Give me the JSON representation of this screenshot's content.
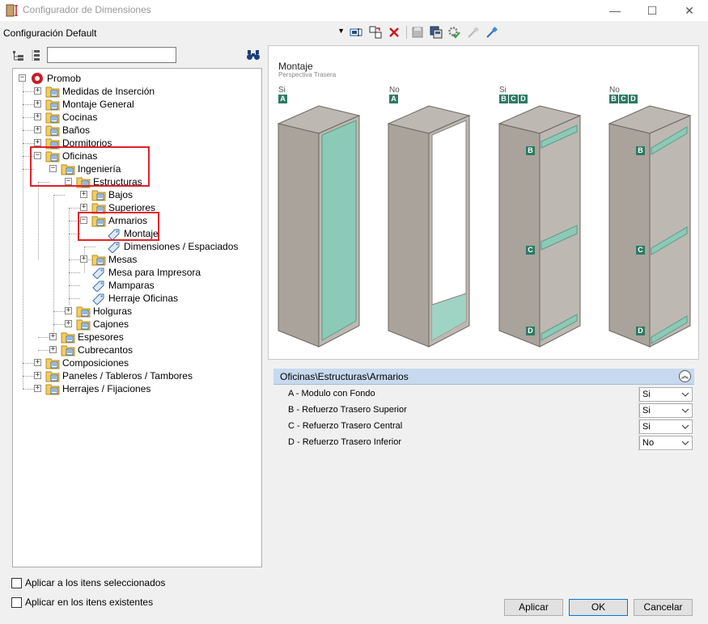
{
  "window": {
    "title": "Configurador de Dimensiones",
    "min": "—",
    "max": "☐",
    "close": "✕"
  },
  "config": {
    "selected": "Configuración Default"
  },
  "search": {
    "value": ""
  },
  "tree": {
    "items": [
      {
        "label": "Promob"
      },
      {
        "label": "Medidas de Inserción"
      },
      {
        "label": "Montaje General"
      },
      {
        "label": "Cocinas"
      },
      {
        "label": "Baños"
      },
      {
        "label": "Dormitorios"
      },
      {
        "label": "Oficinas"
      },
      {
        "label": "Ingeniería"
      },
      {
        "label": "Estructuras"
      },
      {
        "label": "Bajos"
      },
      {
        "label": "Superiores"
      },
      {
        "label": "Armarios"
      },
      {
        "label": "Montaje"
      },
      {
        "label": "Dimensiones / Espaciados"
      },
      {
        "label": "Mesas"
      },
      {
        "label": "Mesa para Impresora"
      },
      {
        "label": "Mamparas"
      },
      {
        "label": "Herraje Oficinas"
      },
      {
        "label": "Holguras"
      },
      {
        "label": "Cajones"
      },
      {
        "label": "Espesores"
      },
      {
        "label": "Cubrecantos"
      },
      {
        "label": "Composiciones"
      },
      {
        "label": "Paneles / Tableros / Tambores"
      },
      {
        "label": "Herrajes / Fijaciones"
      }
    ]
  },
  "preview": {
    "title": "Montaje",
    "subtitle": "Perspectiva Trasera",
    "columns": [
      {
        "label": "Si",
        "badges": [
          "A"
        ]
      },
      {
        "label": "No",
        "badges": [
          "A"
        ]
      },
      {
        "label": "Si",
        "badges": [
          "B",
          "C",
          "D"
        ]
      },
      {
        "label": "No",
        "badges": [
          "B",
          "C",
          "D"
        ]
      }
    ],
    "side_badges": [
      "B",
      "C",
      "D"
    ],
    "colors": {
      "panel": "#8cc9b7",
      "frame": "#bdb8b2",
      "dark_frame": "#6d6761",
      "badge": "#2e7a63"
    }
  },
  "props": {
    "path": "Oficinas\\Estructuras\\Armarios",
    "rows": [
      {
        "name": "A - Modulo con Fondo",
        "value": "Si"
      },
      {
        "name": "B - Refuerzo Trasero Superior",
        "value": "Si"
      },
      {
        "name": "C - Refuerzo Trasero Central",
        "value": "Si"
      },
      {
        "name": "D - Refuerzo Trasero Inferior",
        "value": "No"
      }
    ]
  },
  "options": {
    "apply_selected": "Aplicar a los itens seleccionados",
    "apply_existing": "Aplicar en los itens existentes"
  },
  "buttons": {
    "apply": "Aplicar",
    "ok": "OK",
    "cancel": "Cancelar"
  }
}
